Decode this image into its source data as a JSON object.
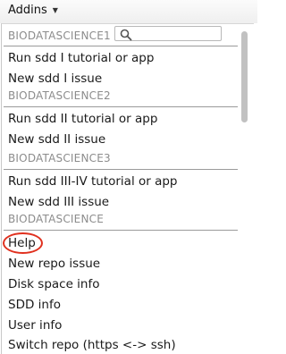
{
  "toolbar": {
    "addins_label": "Addins"
  },
  "search": {
    "placeholder": ""
  },
  "groups": [
    {
      "header": "BIODATASCIENCE1",
      "items": [
        "Run sdd I tutorial or app",
        "New sdd I issue"
      ]
    },
    {
      "header": "BIODATASCIENCE2",
      "items": [
        "Run sdd II tutorial or app",
        "New sdd II issue"
      ]
    },
    {
      "header": "BIODATASCIENCE3",
      "items": [
        "Run sdd III-IV tutorial or app",
        "New sdd III issue"
      ]
    },
    {
      "header": "BIODATASCIENCE",
      "items": [
        "Help",
        "New repo issue",
        "Disk space info",
        "SDD info",
        "User info",
        "Switch repo (https <-> ssh)"
      ]
    }
  ],
  "highlight": {
    "target": "Help",
    "color": "#e0301e"
  },
  "icons": {
    "search": "search-icon",
    "dropdown": "chevron-down-icon"
  }
}
